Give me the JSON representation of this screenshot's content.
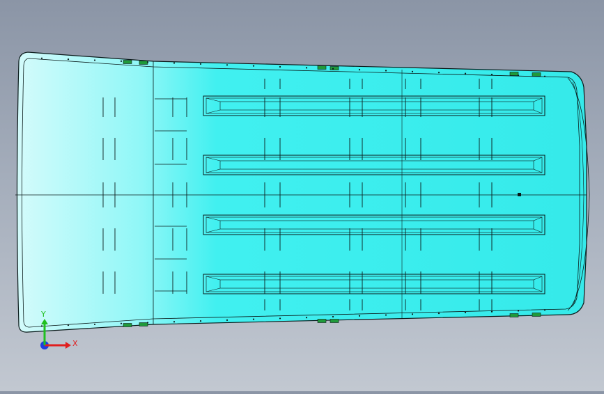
{
  "viewport": {
    "model": "roof panel part",
    "panel_fill": "#3ff0f0",
    "panel_highlight": "#d4fbfb",
    "edge_color": "#0a1a1a"
  },
  "triad": {
    "x_label": "X",
    "y_label": "Y",
    "x_color": "#e01e1e",
    "y_color": "#20c020",
    "z_color": "#1e3ce0"
  },
  "ribs": {
    "count": 4
  }
}
